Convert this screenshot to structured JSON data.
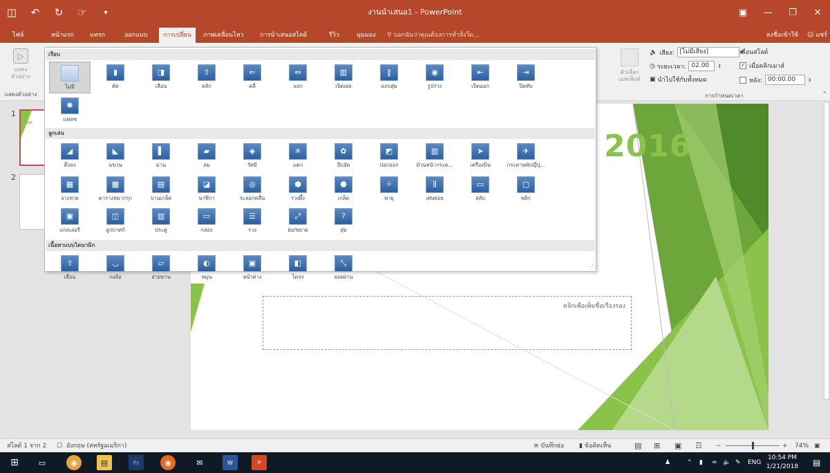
{
  "window": {
    "title": "งานนำเสนอ1 - PowerPoint",
    "qat": [
      "save-icon",
      "undo-icon",
      "redo-icon",
      "touch-mode-icon",
      "customize-icon"
    ]
  },
  "tabs": {
    "file": "ไฟล์",
    "home": "หน้าแรก",
    "insert": "แทรก",
    "design": "ออกแบบ",
    "transitions": "การเปลี่ยน",
    "animations": "ภาพเคลื่อนไหว",
    "slideshow": "การนำเสนอสไลด์",
    "review": "รีวิว",
    "view": "มุมมอง",
    "tellme": "บอกฉันว่าคุณต้องการทำสิ่งใด...",
    "signin": "ลงชื่อเข้าใช้",
    "share": "แชร์"
  },
  "ribbon": {
    "preview_label": "แสดงตัวอย่าง",
    "preview_group": "แสดงตัวอย่าง",
    "effect_options": "ตัวเลือกเอฟเฟ็กต์",
    "sound_label": "เสียง:",
    "sound_value": "[ไม่มีเสียง]",
    "duration_label": "ระยะเวลา:",
    "duration_value": "02.00",
    "apply_all": "นำไปใช้กับทั้งหมด",
    "advance_label": "เลื่อนสไลด์",
    "on_click": "เมื่อคลิกเมาส์",
    "after_label": "หลัง:",
    "after_value": "00:00.00",
    "timing_group": "การกำหนดเวลา"
  },
  "gallery": {
    "section_subtle": "เรียบ",
    "section_exciting": "ลูกเล่น",
    "section_dynamic": "เนื้อหาแบบไดนามิก",
    "subtle": [
      "ไม่มี",
      "ตัด",
      "เลือน",
      "ผลัก",
      "คลี่",
      "แยก",
      "เปิดเผย",
      "แถบสุ่ม",
      "รูปร่าง",
      "เปิดออก",
      "ปิดทับ",
      "แฟลช"
    ],
    "exciting": [
      "ดึงลง",
      "แขวน",
      "ม่าน",
      "ลม",
      "รัศมี",
      "แตก",
      "บีบอัด",
      "ปอกออก",
      "ม้วนหน้ากระด...",
      "เครื่องบิน",
      "กระดาษพับญี่ปุ...",
      "จางหาย",
      "ตารางหมากรุก",
      "บานเกล็ด",
      "นาฬิกา",
      "ระลอกคลื่น",
      "รวงผึ้ง",
      "เกล็ด",
      "พายุ",
      "เศษย่อย",
      "สลับ",
      "พลิก",
      "แกลเลอรี",
      "ลูกบาศก์",
      "ประตู",
      "กล่อง",
      "รวง",
      "ย่อ/ขยาย",
      "สุ่ม"
    ],
    "dynamic": [
      "เลื่อน",
      "กงล้อ",
      "สายพาน",
      "หมุน",
      "หน้าต่าง",
      "โคจร",
      "ลอยผ่าน"
    ]
  },
  "slides": {
    "thumb1_num": "1",
    "thumb2_num": "2",
    "thumb1_text": "Micr",
    "year_text": "2016",
    "subtitle_placeholder": "คลิกเพื่อเพิ่มชื่อเรื่องรอง"
  },
  "status": {
    "slide_count": "สไลด์ 1 จาก 2",
    "language": "อังกฤษ (สหรัฐอเมริกา)",
    "notes": "บันทึกย่อ",
    "comments": "ข้อคิดเห็น",
    "zoom": "74%"
  },
  "taskbar": {
    "lang": "ENG",
    "time": "10:54 PM",
    "date": "1/21/2018"
  },
  "colors": {
    "accent": "#b7472a",
    "slide_green": "#8bc34a"
  }
}
